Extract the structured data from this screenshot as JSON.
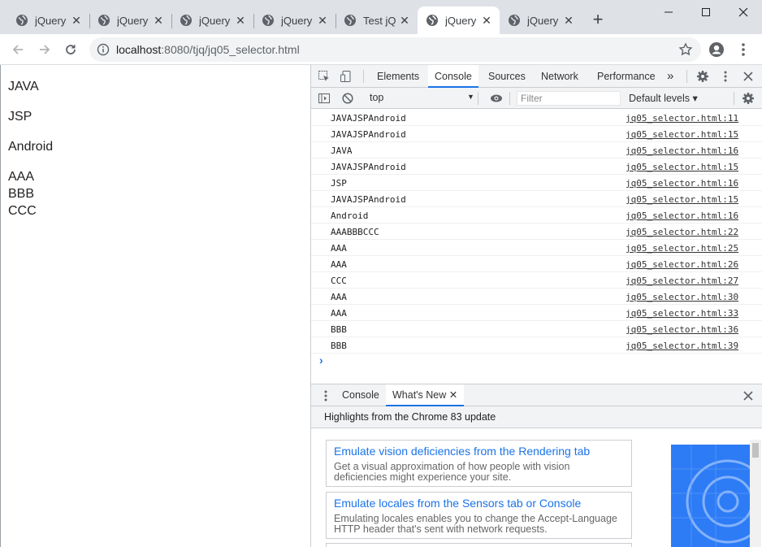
{
  "browser": {
    "tabs": [
      {
        "title": "jQuery"
      },
      {
        "title": "jQuery"
      },
      {
        "title": "jQuery"
      },
      {
        "title": "jQuery"
      },
      {
        "title": "Test jQ"
      },
      {
        "title": "jQuery"
      },
      {
        "title": "jQuery"
      }
    ],
    "active_tab_index": 5,
    "url_host": "localhost",
    "url_path": ":8080/tjq/jq05_selector.html"
  },
  "page": {
    "paragraphs": [
      "JAVA",
      "JSP",
      "Android"
    ],
    "list": [
      "AAA",
      "BBB",
      "CCC"
    ]
  },
  "devtools": {
    "tabs": [
      "Elements",
      "Console",
      "Sources",
      "Network",
      "Performance"
    ],
    "active_tab": "Console",
    "more_label": "»",
    "context": "top",
    "filter_placeholder": "Filter",
    "levels": "Default levels",
    "log": [
      {
        "msg": "JAVAJSPAndroid",
        "src": "jq05_selector.html:11"
      },
      {
        "msg": "JAVAJSPAndroid",
        "src": "jq05_selector.html:15"
      },
      {
        "msg": "JAVA",
        "src": "jq05_selector.html:16"
      },
      {
        "msg": "JAVAJSPAndroid",
        "src": "jq05_selector.html:15"
      },
      {
        "msg": "JSP",
        "src": "jq05_selector.html:16"
      },
      {
        "msg": "JAVAJSPAndroid",
        "src": "jq05_selector.html:15"
      },
      {
        "msg": "Android",
        "src": "jq05_selector.html:16"
      },
      {
        "msg": "AAABBBCCC",
        "src": "jq05_selector.html:22"
      },
      {
        "msg": "AAA",
        "src": "jq05_selector.html:25"
      },
      {
        "msg": "AAA",
        "src": "jq05_selector.html:26"
      },
      {
        "msg": "CCC",
        "src": "jq05_selector.html:27"
      },
      {
        "msg": "AAA",
        "src": "jq05_selector.html:30"
      },
      {
        "msg": "AAA",
        "src": "jq05_selector.html:33"
      },
      {
        "msg": "BBB",
        "src": "jq05_selector.html:36"
      },
      {
        "msg": "BBB",
        "src": "jq05_selector.html:39"
      }
    ],
    "drawer": {
      "tabs": [
        "Console",
        "What's New"
      ],
      "active_tab": "What's New",
      "highlights": "Highlights from the Chrome 83 update",
      "cards": [
        {
          "title": "Emulate vision deficiencies from the Rendering tab",
          "desc": "Get a visual approximation of how people with vision deficiencies might experience your site."
        },
        {
          "title": "Emulate locales from the Sensors tab or Console",
          "desc": "Emulating locales enables you to change the Accept-Language HTTP header that's sent with network requests."
        }
      ]
    }
  },
  "colors": {
    "accent": "#1a73e8",
    "tabstrip": "#dee1e6",
    "promo": "#2d7cf6"
  }
}
